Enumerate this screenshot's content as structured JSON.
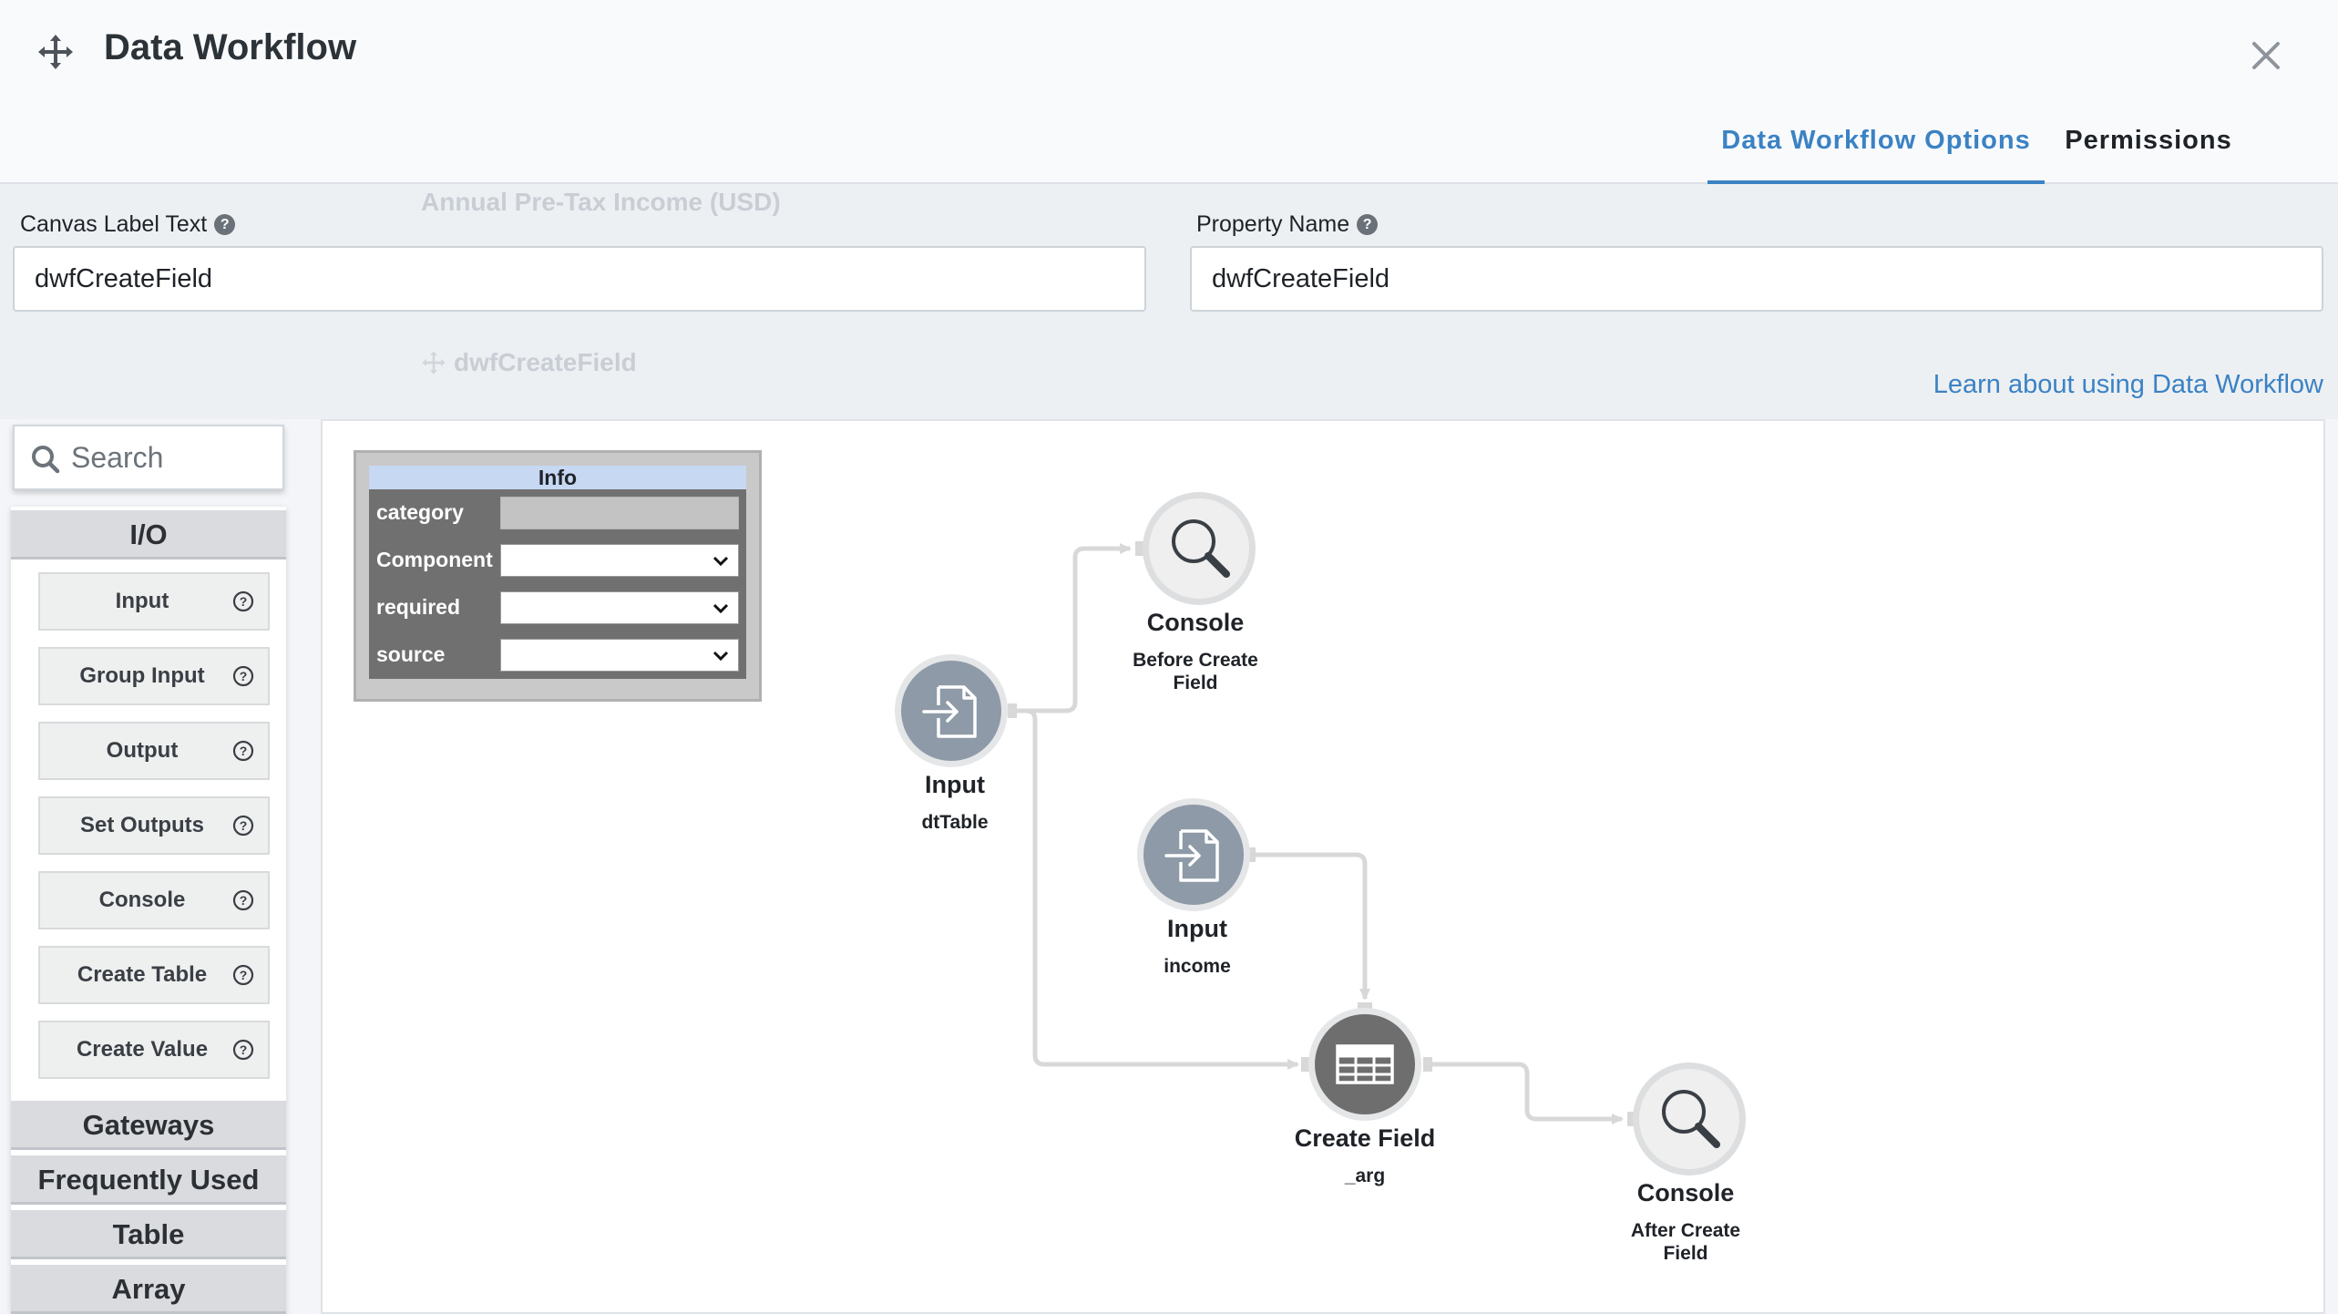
{
  "header": {
    "title": "Data Workflow",
    "tabs": [
      {
        "label": "Data Workflow Options",
        "active": true
      },
      {
        "label": "Permissions",
        "active": false
      }
    ]
  },
  "form": {
    "canvas_label": {
      "label": "Canvas Label Text",
      "value": "dwfCreateField"
    },
    "property_name": {
      "label": "Property Name",
      "value": "dwfCreateField"
    },
    "background_ghost_1": "Annual Pre-Tax Income (USD)",
    "background_ghost_2": "dwfCreateField",
    "learn_link": "Learn about using Data Workflow"
  },
  "palette": {
    "search_placeholder": "Search",
    "categories": [
      "I/O",
      "Gateways",
      "Frequently Used",
      "Table",
      "Array"
    ],
    "io_items": [
      "Input",
      "Group Input",
      "Output",
      "Set Outputs",
      "Console",
      "Create Table",
      "Create Value"
    ]
  },
  "info_panel": {
    "title": "Info",
    "rows": [
      {
        "key": "category",
        "value": ""
      },
      {
        "key": "Component",
        "value": ""
      },
      {
        "key": "required",
        "value": ""
      },
      {
        "key": "source",
        "value": ""
      }
    ]
  },
  "nodes": {
    "input_dttable": {
      "title": "Input",
      "sub": "dtTable"
    },
    "console_before": {
      "title": "Console",
      "sub_line1": "Before Create",
      "sub_line2": "Field"
    },
    "input_income": {
      "title": "Input",
      "sub": "income"
    },
    "create_field": {
      "title": "Create Field",
      "sub": "_arg"
    },
    "console_after": {
      "title": "Console",
      "sub_line1": "After Create",
      "sub_line2": "Field"
    }
  },
  "colors": {
    "accent": "#3b82c4",
    "node_gray": "#8e9aa7",
    "node_dark": "#6e6e6e",
    "edge": "#d8d8d8"
  }
}
